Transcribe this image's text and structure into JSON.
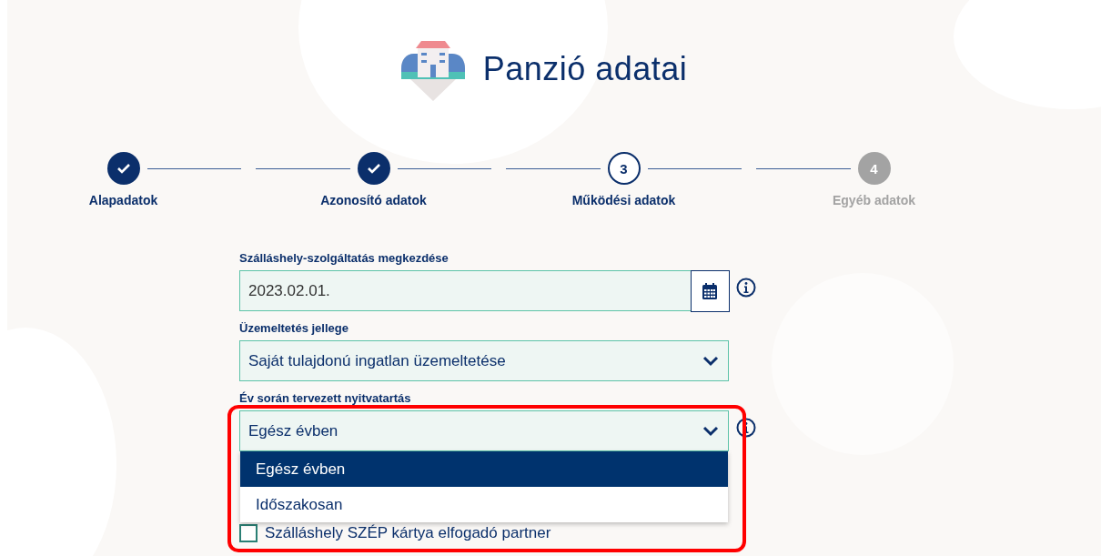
{
  "header": {
    "title": "Panzió adatai"
  },
  "steps": [
    {
      "label": "Alapadatok",
      "kind": "done"
    },
    {
      "label": "Azonosító adatok",
      "kind": "done"
    },
    {
      "label": "Működési adatok",
      "number": "3",
      "kind": "current"
    },
    {
      "label": "Egyéb adatok",
      "number": "4",
      "kind": "pending"
    }
  ],
  "fields": [
    {
      "kind": "date",
      "label": "Szálláshely-szolgáltatás megkezdése",
      "value": "2023.02.01.",
      "info": true
    },
    {
      "kind": "select",
      "label": "Üzemeltetés jellege",
      "value": "Saját tulajdonú ingatlan üzemeltetése"
    },
    {
      "kind": "select",
      "label": "Év során tervezett nyitvatartás",
      "value": "Egész évben",
      "info": true,
      "expanded": true,
      "highlighted": true,
      "options": [
        {
          "label": "Egész évben",
          "selected": true
        },
        {
          "label": "Időszakosan",
          "selected": false
        }
      ]
    }
  ],
  "checkbox": {
    "label": "Szálláshely SZÉP kártya elfogadó partner",
    "checked": false
  }
}
